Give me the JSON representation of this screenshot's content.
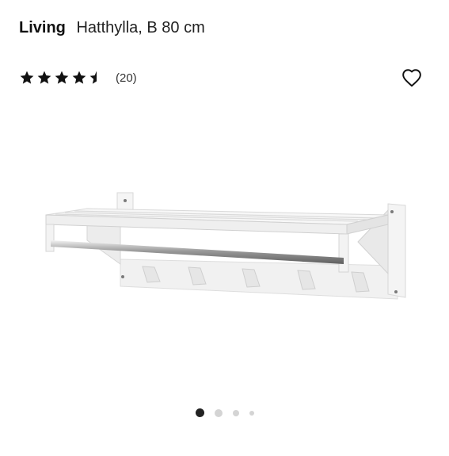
{
  "product": {
    "brand": "Living",
    "description": "Hatthylla, B 80 cm",
    "rating": 4.5,
    "reviews_label": "(20)",
    "favorite_icon": "heart-outline-icon",
    "image_alt": "white wall-mounted hat shelf with chrome rail and hooks"
  },
  "colors": {
    "star": "#111111",
    "dot_active": "#222222",
    "dot_inactive": "#d4d4d4"
  },
  "carousel": {
    "total": 4,
    "active": 0
  }
}
